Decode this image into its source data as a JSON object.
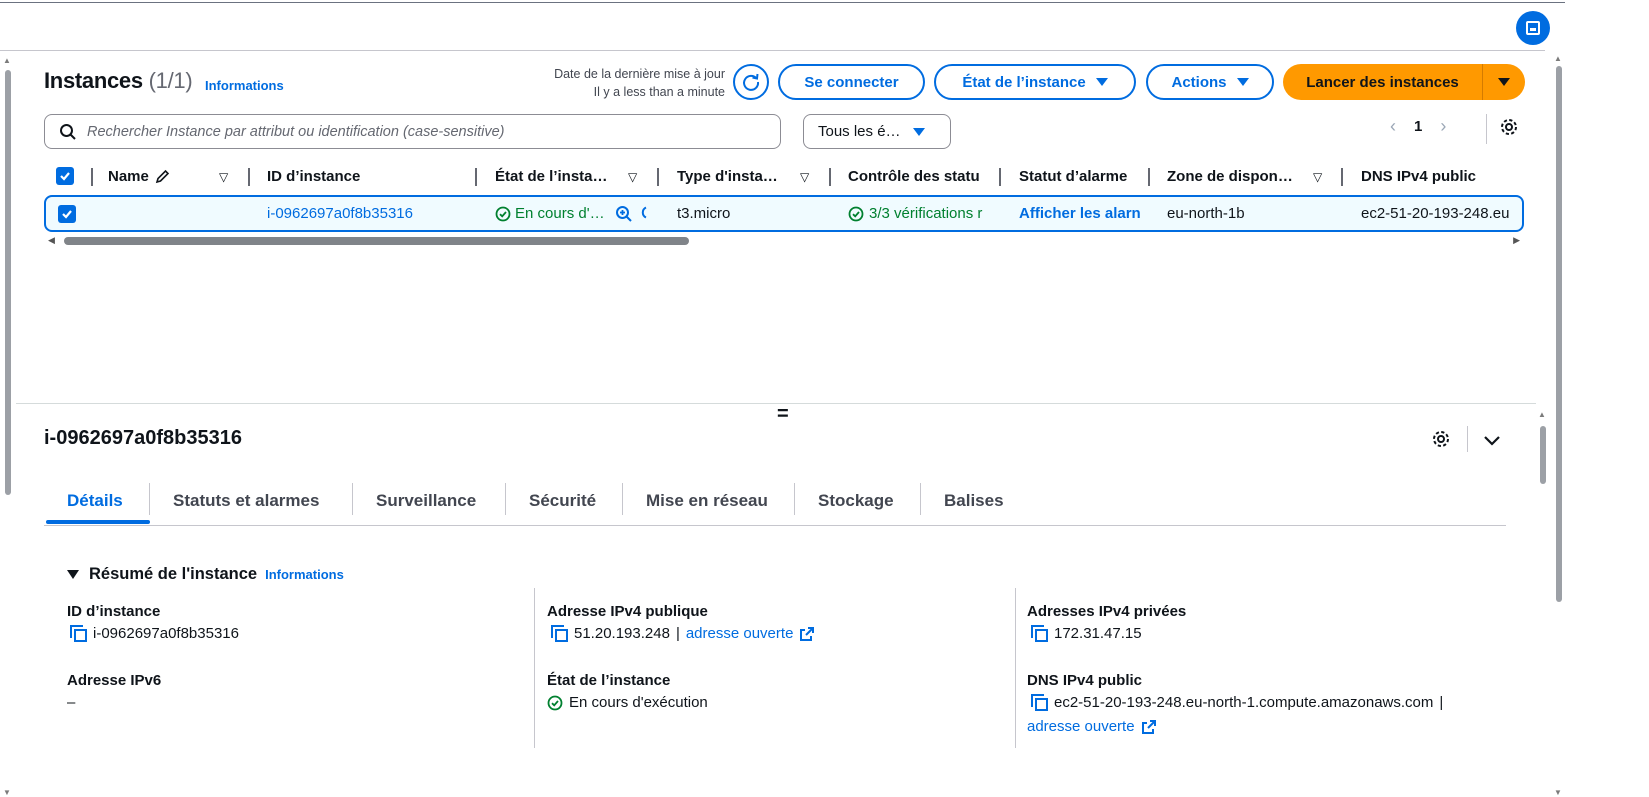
{
  "header": {
    "title": "Instances",
    "count": "(1/1)",
    "info_link": "Informations",
    "last_update_label": "Date de la dernière mise à jour",
    "last_update_value": "Il y a less than a minute",
    "connect_label": "Se connecter",
    "instance_state_label": "État de l’instance",
    "actions_label": "Actions",
    "launch_label": "Lancer des instances"
  },
  "search": {
    "placeholder": "Rechercher Instance par attribut ou identification (case-sensitive)"
  },
  "filter": {
    "value": "Tous les é…"
  },
  "pagination": {
    "prev": "‹",
    "current_page": "1",
    "next": "›"
  },
  "table": {
    "columns": [
      "Name",
      "ID d’instance",
      "État de l’insta…",
      "Type d'insta…",
      "Contrôle des statu",
      "Statut d’alarme",
      "Zone de dispon…",
      "DNS IPv4 public"
    ],
    "rows": [
      {
        "name": "",
        "instance_id": "i-0962697a0f8b35316",
        "state": "En cours d'…",
        "type": "t3.micro",
        "status_check": "3/3 vérifications r",
        "alarm_status": "Afficher les alarn",
        "zone": "eu-north-1b",
        "dns": "ec2-51-20-193-248.eu"
      }
    ]
  },
  "detail": {
    "title": "i-0962697a0f8b35316",
    "tabs": [
      "Détails",
      "Statuts et alarmes",
      "Surveillance",
      "Sécurité",
      "Mise en réseau",
      "Stockage",
      "Balises"
    ],
    "active_tab": "Détails",
    "summary_title": "Résumé de l'instance",
    "summary_info": "Informations",
    "fields": {
      "instance_id_label": "ID d’instance",
      "instance_id_value": "i-0962697a0f8b35316",
      "ipv6_label": "Adresse IPv6",
      "ipv6_value": "–",
      "public_ipv4_label": "Adresse IPv4 publique",
      "public_ipv4_value": "51.20.193.248",
      "public_ipv4_sep": "|",
      "open_address": "adresse ouverte",
      "state_label": "État de l’instance",
      "state_value": "En cours d'exécution",
      "private_ipv4_label": "Adresses IPv4 privées",
      "private_ipv4_value": "172.31.47.15",
      "public_dns_label": "DNS IPv4 public",
      "public_dns_value": "ec2-51-20-193-248.eu-north-1.compute.amazonaws.com",
      "public_dns_sep": "|",
      "open_address_2": "adresse ouverte"
    }
  },
  "colors": {
    "primary": "#006ce0",
    "launch": "#ff9900",
    "success": "#00802f",
    "text": "#0f141a",
    "selected_row_bg": "#f0fbff"
  },
  "icons": [
    "fullscreen-icon",
    "refresh-icon",
    "search-icon",
    "settings-gear-icon",
    "edit-pencil-icon",
    "sort-icon",
    "checkbox-checked-icon",
    "check-circle-icon",
    "zoom-in-icon",
    "copy-icon",
    "external-link-icon",
    "chevron-down-icon",
    "resize-grip-icon"
  ]
}
